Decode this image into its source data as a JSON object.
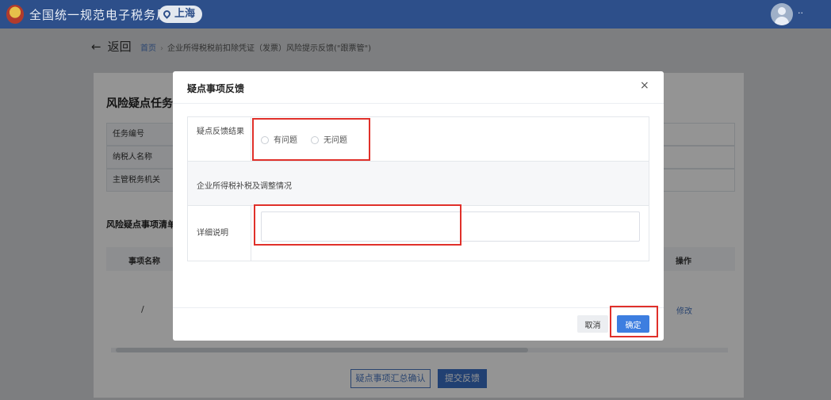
{
  "header": {
    "app_title": "全国统一规范电子税务局",
    "region": "上海",
    "user_name": "··"
  },
  "page": {
    "back_label": "返回",
    "breadcrumb": {
      "home": "首页",
      "separator": "›",
      "current": "企业所得税税前扣除凭证（发票）风险提示反馈(\"跟票管\")"
    },
    "task_section_title": "风险疑点任务",
    "info_labels": [
      "任务编号",
      "纳税人名称",
      "主管税务机关"
    ],
    "list_section_title": "风险疑点事项清单",
    "list_headers": {
      "item_name": "事项名称",
      "action": "操作"
    },
    "row_value": "/",
    "row_action": "修改",
    "summary_button": "疑点事项汇总确认",
    "submit_button": "提交反馈"
  },
  "modal": {
    "title": "疑点事项反馈",
    "close": "×",
    "result_label": "疑点反馈结果",
    "radio_options": [
      "有问题",
      "无问题"
    ],
    "section_text": "企业所得税补税及调整情况",
    "detail_label": "详细说明",
    "detail_value": "",
    "cancel_label": "取消",
    "confirm_label": "确定"
  },
  "colors": {
    "header_bg": "#2d4f8a",
    "primary": "#3d7ee0",
    "highlight": "#e0302a"
  }
}
